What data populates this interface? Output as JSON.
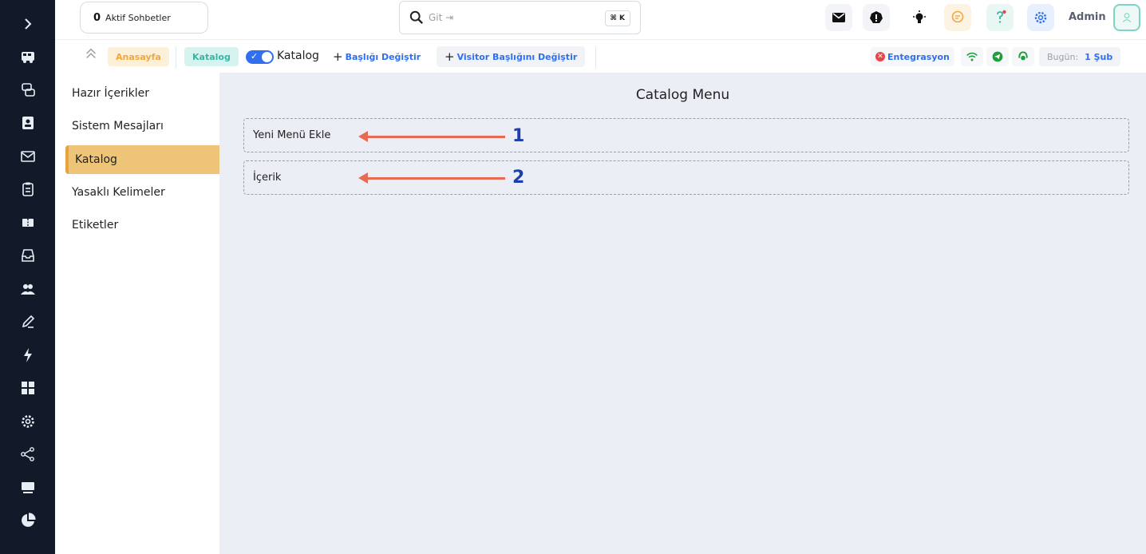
{
  "topbar": {
    "active_count": "0",
    "active_label": "Aktif Sohbetler",
    "search_placeholder": "Git ⇥",
    "shortcut": "⌘ K",
    "admin_label": "Admin"
  },
  "subbar": {
    "home_chip": "Anasayfa",
    "catalog_chip": "Katalog",
    "toggle_label": "Katalog",
    "change_title": "Başlığı Değiştir",
    "change_visitor_title": "Visitor Başlığını Değiştir",
    "integration": "Entegrasyon",
    "today_label": "Bugün:",
    "today_value": "1 Şub"
  },
  "sidebar": {
    "items": [
      {
        "label": "Hazır İçerikler",
        "active": false
      },
      {
        "label": "Sistem Mesajları",
        "active": false
      },
      {
        "label": "Katalog",
        "active": true
      },
      {
        "label": "Yasaklı Kelimeler",
        "active": false
      },
      {
        "label": "Etiketler",
        "active": false
      }
    ]
  },
  "main": {
    "title": "Catalog Menu",
    "boxes": [
      {
        "label": "Yeni Menü Ekle",
        "annotation": "1"
      },
      {
        "label": "İçerik",
        "annotation": "2"
      }
    ]
  },
  "colors": {
    "rail": "#121a29",
    "accent_blue": "#2f6ff0",
    "active_item": "#eec578",
    "arrow": "#e86a53",
    "annotation_number": "#1d3fae"
  },
  "icons": [
    "chevron-right-icon",
    "bus-icon",
    "chat-bubbles-icon",
    "contact-card-icon",
    "mail-icon",
    "clipboard-icon",
    "ticket-icon",
    "inbox-icon",
    "users-icon",
    "pen-icon",
    "lightning-icon",
    "grid-icon",
    "settings-icon",
    "share-icon",
    "monitor-icon",
    "pie-chart-icon"
  ]
}
